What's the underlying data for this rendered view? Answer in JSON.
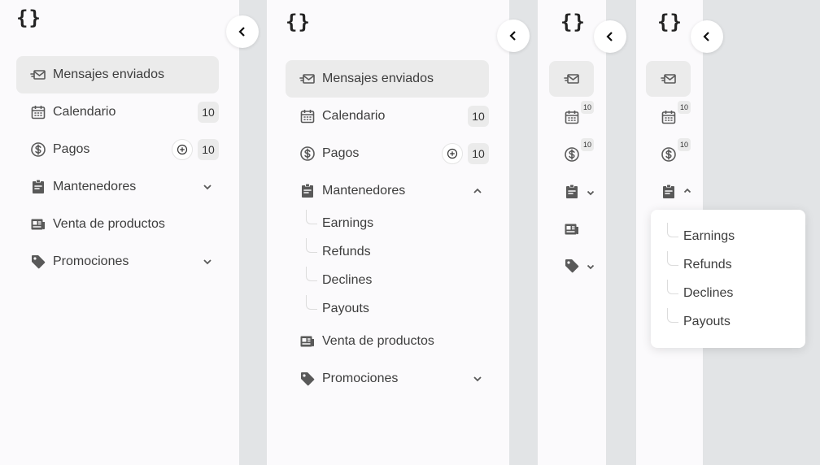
{
  "logo": "{}",
  "nav": {
    "sent": "Mensajes enviados",
    "calendar": "Calendario",
    "payments": "Pagos",
    "maintainers": "Mantenedores",
    "sales": "Venta de productos",
    "promos": "Promociones"
  },
  "badges": {
    "calendar": "10",
    "payments": "10"
  },
  "submenu": [
    "Earnings",
    "Refunds",
    "Declines",
    "Payouts"
  ],
  "colors": {
    "panel": "#fbfafc",
    "background": "#e2e4e6",
    "active": "#ebebeb",
    "text": "#3d3d3d",
    "icon": "#595959"
  },
  "icons": [
    "logo-braces-icon",
    "chevron-left-icon",
    "mail-send-icon",
    "calendar-icon",
    "dollar-circle-icon",
    "clipboard-icon",
    "newspaper-icon",
    "tag-icon",
    "chevron-down-icon",
    "chevron-up-icon",
    "plus-circle-icon"
  ]
}
